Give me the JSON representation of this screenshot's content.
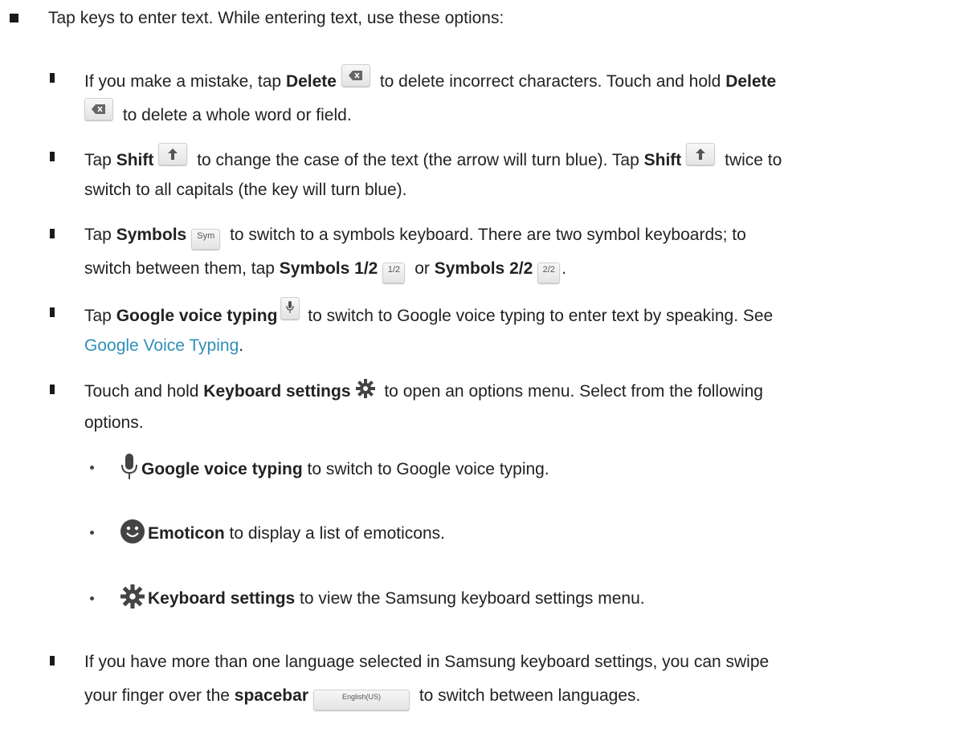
{
  "intro": "Tap keys to enter text. While entering text, use these options:",
  "delete": {
    "l1_pre": "If you make a mistake, tap ",
    "bold1": "Delete",
    "l1_mid": " to delete incorrect characters. Touch and hold ",
    "bold2": "Delete",
    "l2": " to delete a whole word or field."
  },
  "shift": {
    "l1_pre": "Tap ",
    "bold1": "Shift",
    "l1_mid": " to change the case of the text (the arrow will turn blue). Tap ",
    "bold2": "Shift",
    "l1_post": " twice to",
    "l2": "switch to all capitals (the key will turn blue)."
  },
  "symbols": {
    "l1_pre": "Tap ",
    "bold1": "Symbols",
    "key_sym": "Sym",
    "l1_post": " to switch to a symbols keyboard. There are two symbol keyboards; to",
    "l2_pre": "switch between them, tap ",
    "bold2": "Symbols 1/2",
    "key_12": "1/2",
    "l2_or": " or ",
    "bold3": "Symbols 2/2",
    "key_22": "2/2",
    "l2_end": "."
  },
  "voice": {
    "l1_pre": "Tap ",
    "bold1": "Google voice typing",
    "l1_post": " to switch to Google voice typing to enter text by speaking. See",
    "link": "Google Voice Typing",
    "l2_end": "."
  },
  "settings": {
    "l1_pre": "Touch and hold ",
    "bold1": "Keyboard settings",
    "l1_post": " to open an options menu. Select from the following",
    "l2": "options."
  },
  "sub": [
    {
      "icon": "microphone-icon",
      "bold": "Google voice typing",
      "text": " to switch to Google voice typing."
    },
    {
      "icon": "emoticon-icon",
      "bold": "Emoticon",
      "text": " to display a list of emoticons."
    },
    {
      "icon": "gear-icon",
      "bold": "Keyboard settings",
      "text": " to view the Samsung keyboard settings menu."
    }
  ],
  "language": {
    "l1": "If you have more than one language selected in Samsung keyboard settings, you can swipe",
    "l2_pre": "your finger over the ",
    "bold": "spacebar",
    "key_space": "English(US)",
    "l2_post": " to switch between languages."
  }
}
